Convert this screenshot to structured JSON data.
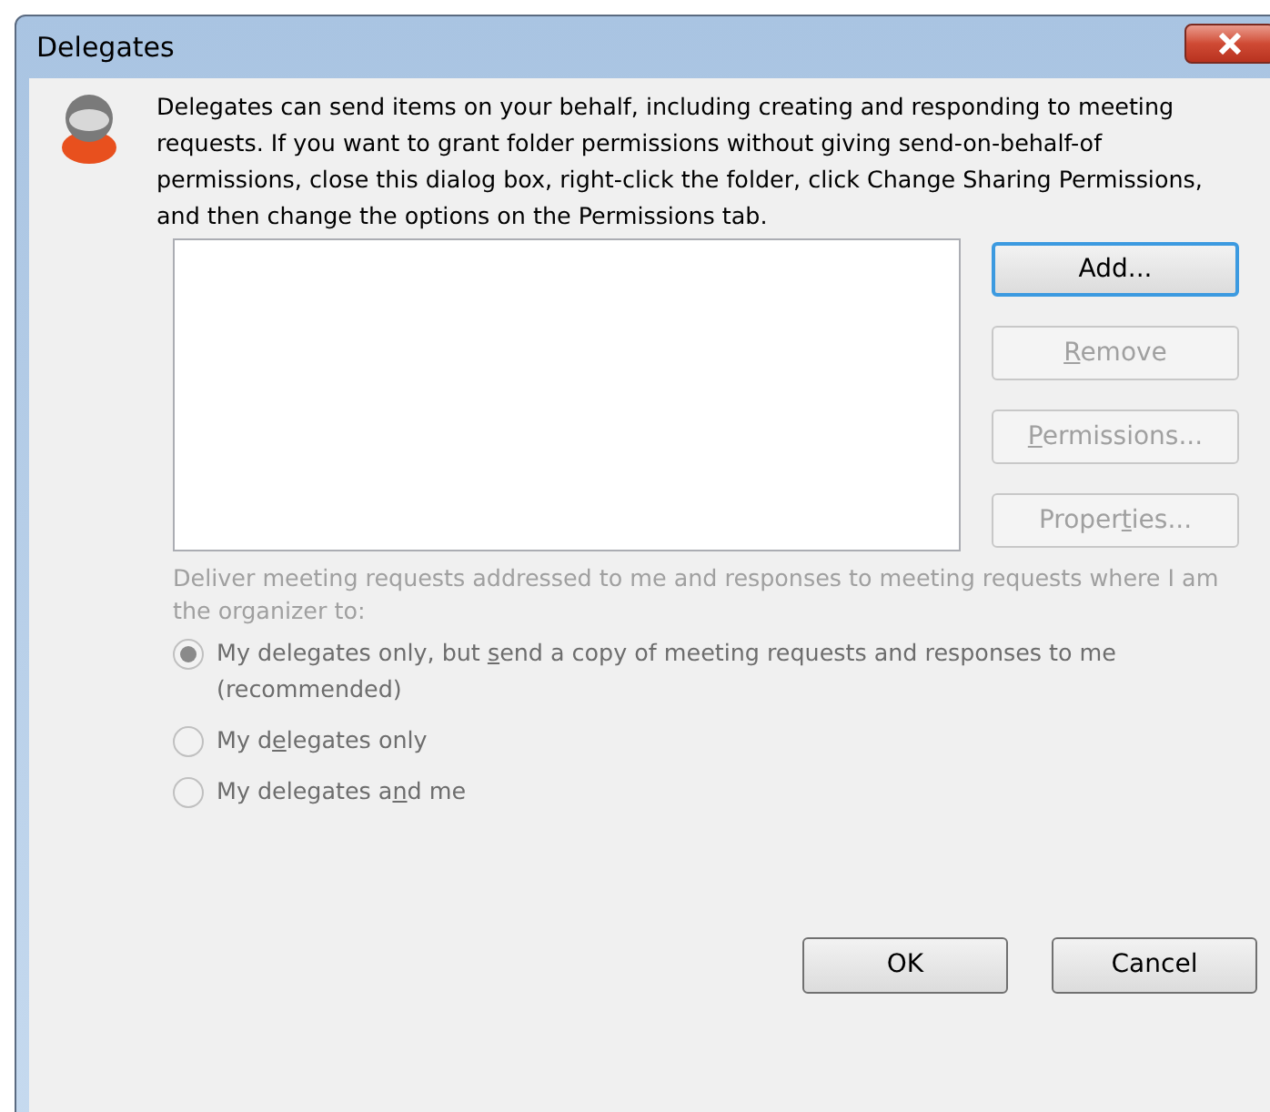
{
  "window": {
    "title": "Delegates"
  },
  "description": "Delegates can send items on your behalf, including creating and responding to meeting requests. If you want to grant folder permissions without giving send-on-behalf-of permissions, close this dialog box, right-click the folder, click Change Sharing Permissions, and then change the options on the Permissions tab.",
  "side_buttons": [
    {
      "before": "Add...",
      "disabled": false,
      "default": true
    },
    {
      "key": "R",
      "after": "emove",
      "disabled": true,
      "default": false
    },
    {
      "key": "P",
      "after": "ermissions...",
      "disabled": true,
      "default": false
    },
    {
      "before": "Proper",
      "key": "t",
      "after": "ies...",
      "disabled": true,
      "default": false
    }
  ],
  "deliver_label": {
    "text": "Deliver meeting requests addressed to me and responses to meeting requests where I am the organizer to:",
    "disabled": true
  },
  "options": [
    {
      "before": "My delegates only, but ",
      "key": "s",
      "after": "end a copy of meeting requests and responses to me (recommended)",
      "selected": true,
      "disabled": true
    },
    {
      "before": "My d",
      "key": "e",
      "after": "legates only",
      "selected": false,
      "disabled": true
    },
    {
      "before": "My delegates a",
      "key": "n",
      "after": "d me",
      "selected": false,
      "disabled": true
    }
  ],
  "buttons": [
    "OK",
    "Cancel"
  ]
}
